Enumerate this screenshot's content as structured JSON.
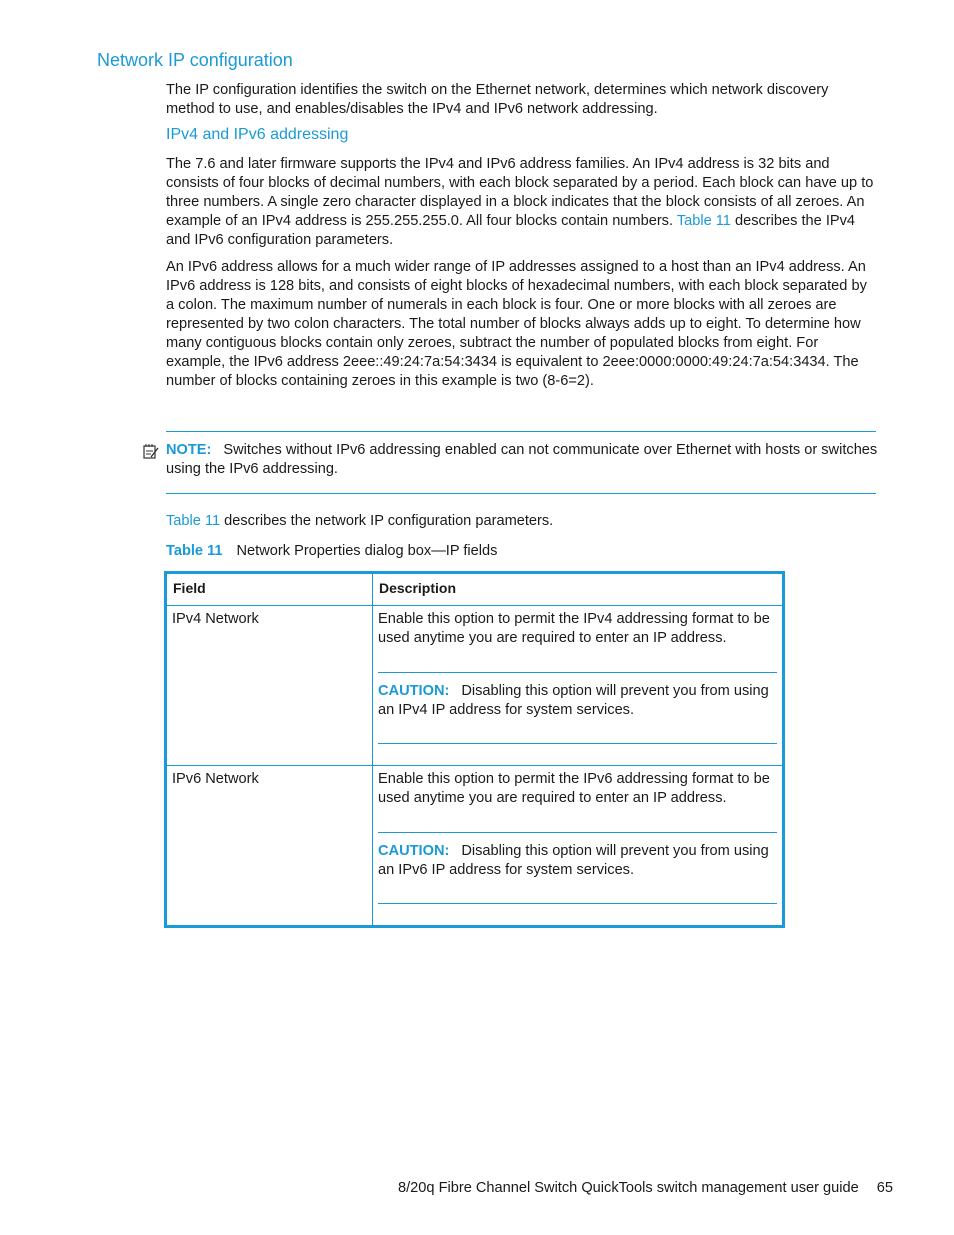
{
  "heading": "Network IP configuration",
  "intro": "The IP configuration identifies the switch on the Ethernet network, determines which network discovery method to use, and enables/disables the IPv4 and IPv6 network addressing.",
  "subheading": "IPv4 and IPv6 addressing",
  "para1_before_link": "The 7.6 and later firmware supports the IPv4 and IPv6 address families. An IPv4 address is 32 bits and consists of four blocks of decimal numbers, with each block separated by a period. Each block can have up to three numbers. A single zero character displayed in a block indicates that the block consists of all zeroes. An example of an IPv4 address is 255.255.255.0. All four blocks contain numbers. ",
  "para1_link": "Table 11",
  "para1_after_link": " describes the IPv4 and IPv6 configuration parameters.",
  "para2": "An IPv6 address allows for a much wider range of IP addresses assigned to a host than an IPv4 address. An IPv6 address is 128 bits, and consists of eight blocks of hexadecimal numbers, with each block separated by a colon. The maximum number of numerals in each block is four. One or more blocks with all zeroes are represented by two colon characters. The total number of blocks always adds up to eight. To determine how many contiguous blocks contain only zeroes, subtract the number of populated blocks from eight. For example, the IPv6 address 2eee::49:24:7a:54:3434 is equivalent to 2eee:0000:0000:49:24:7a:54:3434. The number of blocks containing zeroes in this example is two (8-6=2).",
  "note": {
    "label": "NOTE:",
    "text": "Switches without IPv6 addressing enabled can not communicate over Ethernet with hosts or switches using the IPv6 addressing."
  },
  "table_ref": {
    "link": "Table 11",
    "text": " describes the network IP configuration parameters."
  },
  "caption": {
    "number": "Table 11",
    "title": "Network Properties dialog box—IP fields"
  },
  "table": {
    "headers": [
      "Field",
      "Description"
    ],
    "rows": [
      {
        "field": "IPv4 Network",
        "description": "Enable this option to permit the IPv4 addressing format to be used anytime you are required to enter an IP address.",
        "caution_label": "CAUTION:",
        "caution_text": "Disabling this option will prevent you from using an IPv4 IP address for system services."
      },
      {
        "field": "IPv6 Network",
        "description": "Enable this option to permit the IPv6 addressing format to be used anytime you are required to enter an IP address.",
        "caution_label": "CAUTION:",
        "caution_text": "Disabling this option will prevent you from using an IPv6 IP address for system services."
      }
    ]
  },
  "footer": {
    "title": "8/20q Fibre Channel Switch QuickTools switch management user guide",
    "page": "65"
  }
}
